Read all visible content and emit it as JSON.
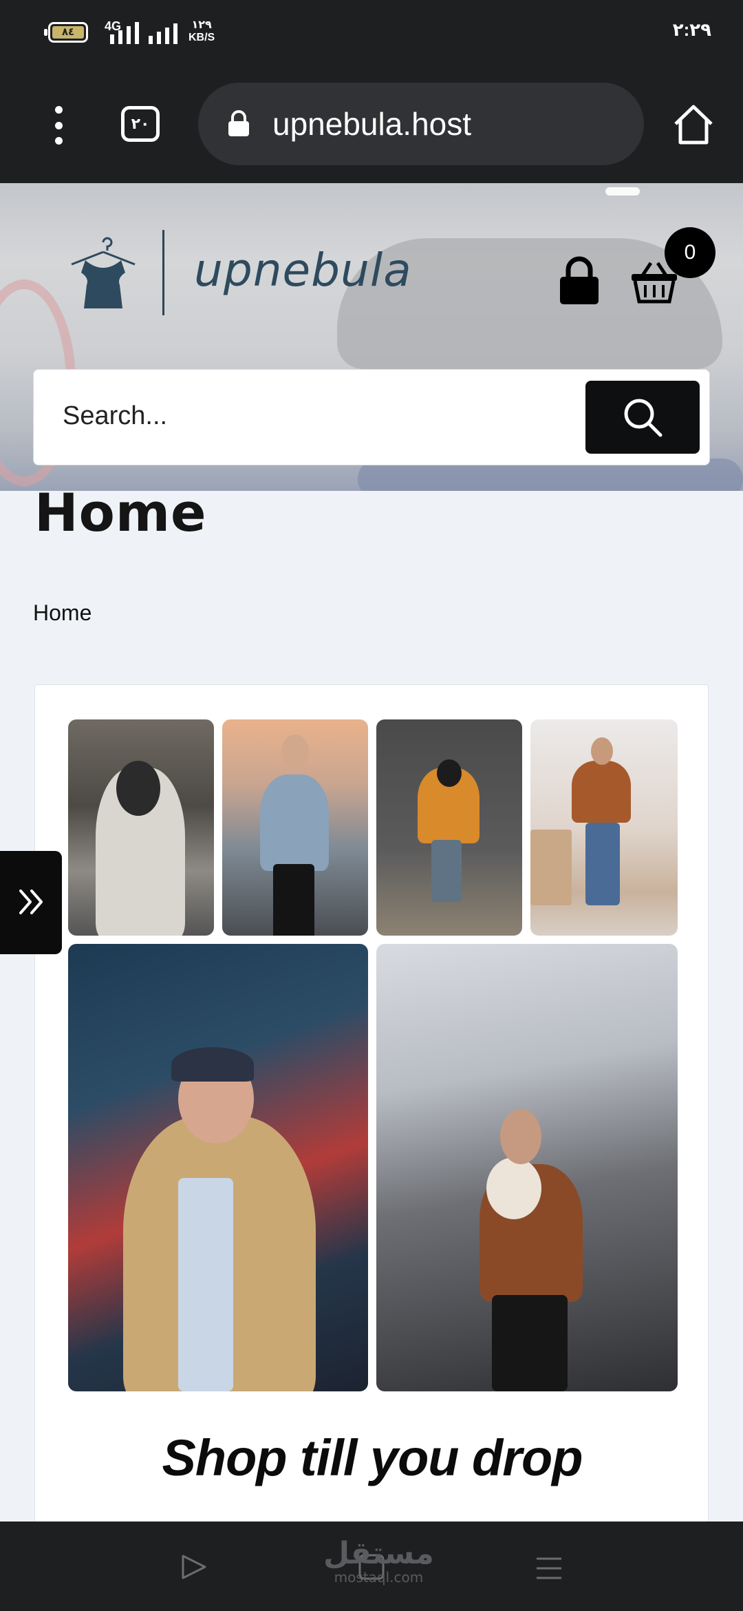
{
  "status_bar": {
    "battery_level": "٨٤",
    "network_type": "4G",
    "speed_value": "١٢٩",
    "speed_unit": "KB/S",
    "time": "٢:٢٩"
  },
  "browser": {
    "tab_count": "٢٠",
    "url": "upnebula.host"
  },
  "header": {
    "logo_text": "upnebula",
    "cart_count": "0",
    "search_placeholder": "Search..."
  },
  "page": {
    "title": "Home",
    "breadcrumb": "Home"
  },
  "gallery": {
    "tagline": "Shop till you drop"
  },
  "watermark": {
    "arabic": "مستقل",
    "latin": "mostaql.com"
  },
  "colors": {
    "bar_background": "#1e1f21",
    "page_background": "#eff3f7",
    "logo_color": "#2e4a5e",
    "button_black": "#0e0f10"
  },
  "icons": [
    "menu-kebab-icon",
    "tabs-icon",
    "lock-icon",
    "home-icon",
    "hanger-logo-icon",
    "padlock-icon",
    "basket-icon",
    "search-icon",
    "double-chevron-right-icon",
    "play-back-icon",
    "square-home-icon",
    "hamburger-icon"
  ]
}
